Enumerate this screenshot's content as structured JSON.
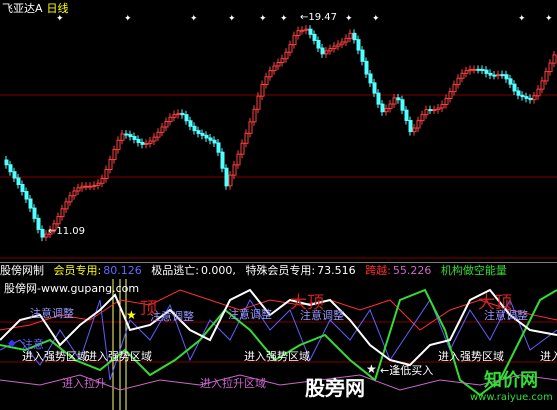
{
  "main_panel": {
    "title": "飞亚达A",
    "period": "日线",
    "price_high_label": "19.47",
    "price_low_label": "11.09",
    "colors": {
      "up": "#ff4040",
      "down": "#54ffff",
      "grid": "#800000",
      "background": "#000000"
    }
  },
  "indicator_bar": {
    "name": "股傍网制",
    "item1_label": "会员专用:",
    "item1_value": "80.126",
    "item2_label": "极品逃亡:",
    "item2_value": "0.000,",
    "item3_label": "特殊会员专用:",
    "item3_value": "73.516",
    "item4_label": "跨越:",
    "item4_value": "55.226",
    "item5_label": "机构做空能量"
  },
  "indicator_panel": {
    "watermark_site": "股傍网-www.gupang.com",
    "labels": {
      "attention_adjust_1": "注意调整",
      "attention_adjust_2": "注意调整",
      "attention_adjust_3": "注意调整",
      "attention_adjust_4": "注意调整",
      "attention_adjust_5": "注意调整",
      "top_1": "顶",
      "top_2": "大顶",
      "top_3": "大顶",
      "enter_strong_1": "进入强势区域",
      "enter_strong_2": "进入强势区域",
      "enter_strong_3": "进入强势区域",
      "enter_strong_4": "进入强势区域",
      "enter_strong_5": "进入强势区域",
      "enter_pull_1": "进入拉升",
      "enter_pull_2": "进入拉升区域",
      "buy_low": "逢低买入",
      "legend_partial": "注意",
      "watermark_bottom": "股旁网",
      "watermark_logo": "知价网",
      "watermark_url": "www.raiyue.com"
    }
  }
}
